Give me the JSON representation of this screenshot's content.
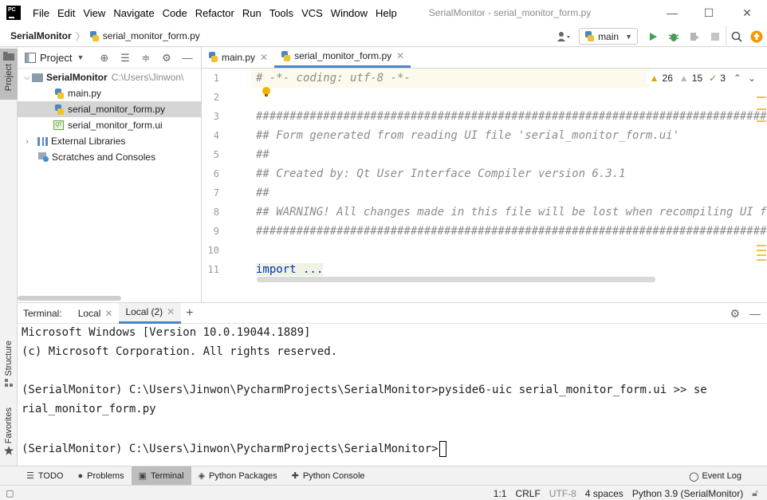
{
  "titlebar": {
    "menus": [
      "File",
      "Edit",
      "View",
      "Navigate",
      "Code",
      "Refactor",
      "Run",
      "Tools",
      "VCS",
      "Window",
      "Help"
    ],
    "window_title": "SerialMonitor - serial_monitor_form.py",
    "minimize": "—",
    "maximize": "☐",
    "close": "✕"
  },
  "navbar": {
    "project": "SerialMonitor",
    "separator": "〉",
    "file": "serial_monitor_form.py",
    "run_config": "main",
    "dropdown": "▼"
  },
  "left_stripe": {
    "project": "Project",
    "structure": "Structure",
    "favorites": "Favorites"
  },
  "project_panel": {
    "title": "Project",
    "root": {
      "name": "SerialMonitor",
      "path": "C:\\Users\\Jinwon\\"
    },
    "files": [
      "main.py",
      "serial_monitor_form.py",
      "serial_monitor_form.ui"
    ],
    "external": "External Libraries",
    "scratches": "Scratches and Consoles",
    "ui_icon_label": "QT"
  },
  "editor": {
    "tabs": [
      {
        "label": "main.py",
        "active": false
      },
      {
        "label": "serial_monitor_form.py",
        "active": true
      }
    ],
    "inspections": {
      "warnings": "26",
      "weak_warnings": "15",
      "typos": "3"
    },
    "line_numbers": [
      "1",
      "2",
      "3",
      "4",
      "5",
      "6",
      "7",
      "8",
      "9",
      "10",
      "11"
    ],
    "lines": [
      "# -*- coding: utf-8 -*-",
      "",
      "################################################################################",
      "## Form generated from reading UI file 'serial_monitor_form.ui'",
      "##",
      "## Created by: Qt User Interface Compiler version 6.3.1",
      "##",
      "## WARNING! All changes made in this file will be lost when recompiling UI file!",
      "################################################################################",
      "",
      "import ..."
    ]
  },
  "terminal": {
    "label": "Terminal:",
    "tabs": [
      {
        "label": "Local",
        "active": false
      },
      {
        "label": "Local (2)",
        "active": true
      }
    ],
    "lines": [
      "Microsoft Windows [Version 10.0.19044.1889]",
      "(c) Microsoft Corporation. All rights reserved.",
      "",
      "(SerialMonitor) C:\\Users\\Jinwon\\PycharmProjects\\SerialMonitor>pyside6-uic serial_monitor_form.ui >> se",
      "rial_monitor_form.py",
      "",
      "(SerialMonitor) C:\\Users\\Jinwon\\PycharmProjects\\SerialMonitor>"
    ]
  },
  "toolwindows": [
    "TODO",
    "Problems",
    "Terminal",
    "Python Packages",
    "Python Console"
  ],
  "event_log": "Event Log",
  "statusbar": {
    "position": "1:1",
    "line_sep": "CRLF",
    "encoding": "UTF-8",
    "indent": "4 spaces",
    "interpreter": "Python 3.9 (SerialMonitor)"
  }
}
